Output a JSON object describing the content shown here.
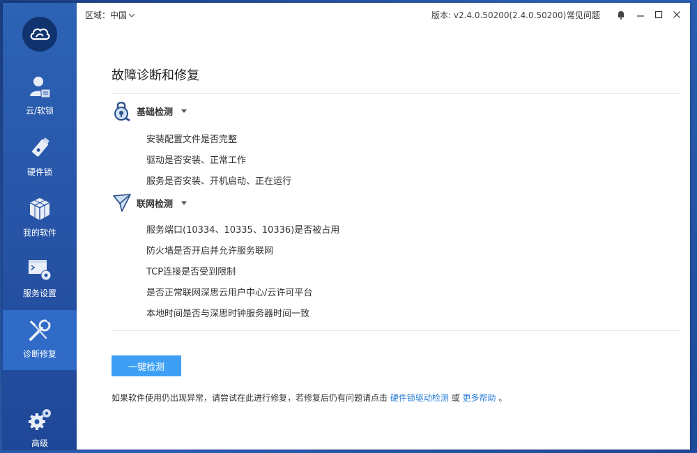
{
  "titlebar": {
    "region_label": "区域：中国",
    "version_label": "版本: v2.4.0.50200(2.4.0.50200)",
    "faq_label": "常见问题"
  },
  "sidebar": {
    "items": [
      {
        "label": "云/软锁",
        "icon": "user-card-icon"
      },
      {
        "label": "硬件锁",
        "icon": "usb-key-icon"
      },
      {
        "label": "我的软件",
        "icon": "cubes-icon"
      },
      {
        "label": "服务设置",
        "icon": "terminal-gear-icon"
      },
      {
        "label": "诊断修复",
        "icon": "tools-icon",
        "active": true
      },
      {
        "label": "高级",
        "icon": "gears-icon"
      }
    ]
  },
  "main": {
    "title": "故障诊断和修复",
    "sections": [
      {
        "title": "基础检测",
        "icon": "lock-search-icon",
        "items": [
          "安装配置文件是否完整",
          "驱动是否安装、正常工作",
          "服务是否安装、开机启动、正在运行"
        ]
      },
      {
        "title": "联网检测",
        "icon": "paper-plane-icon",
        "items": [
          "服务端口(10334、10335、10336)是否被占用",
          "防火墙是否开启并允许服务联网",
          "TCP连接是否受到限制",
          "是否正常联网深思云用户中心/云许可平台",
          "本地时间是否与深思时钟服务器时间一致"
        ]
      }
    ],
    "check_button": "一键检测",
    "footer": {
      "prefix": "如果软件使用仍出现异常，请尝试在此进行修复，若修复后仍有问题请点击",
      "link1": "硬件锁驱动检测",
      "middle": "或",
      "link2": "更多帮助",
      "suffix": "。"
    }
  },
  "colors": {
    "sidebar": "#2754a6",
    "sidebar_active": "#2f6bc7",
    "button": "#3ea0f5",
    "link": "#2a7fd8"
  }
}
